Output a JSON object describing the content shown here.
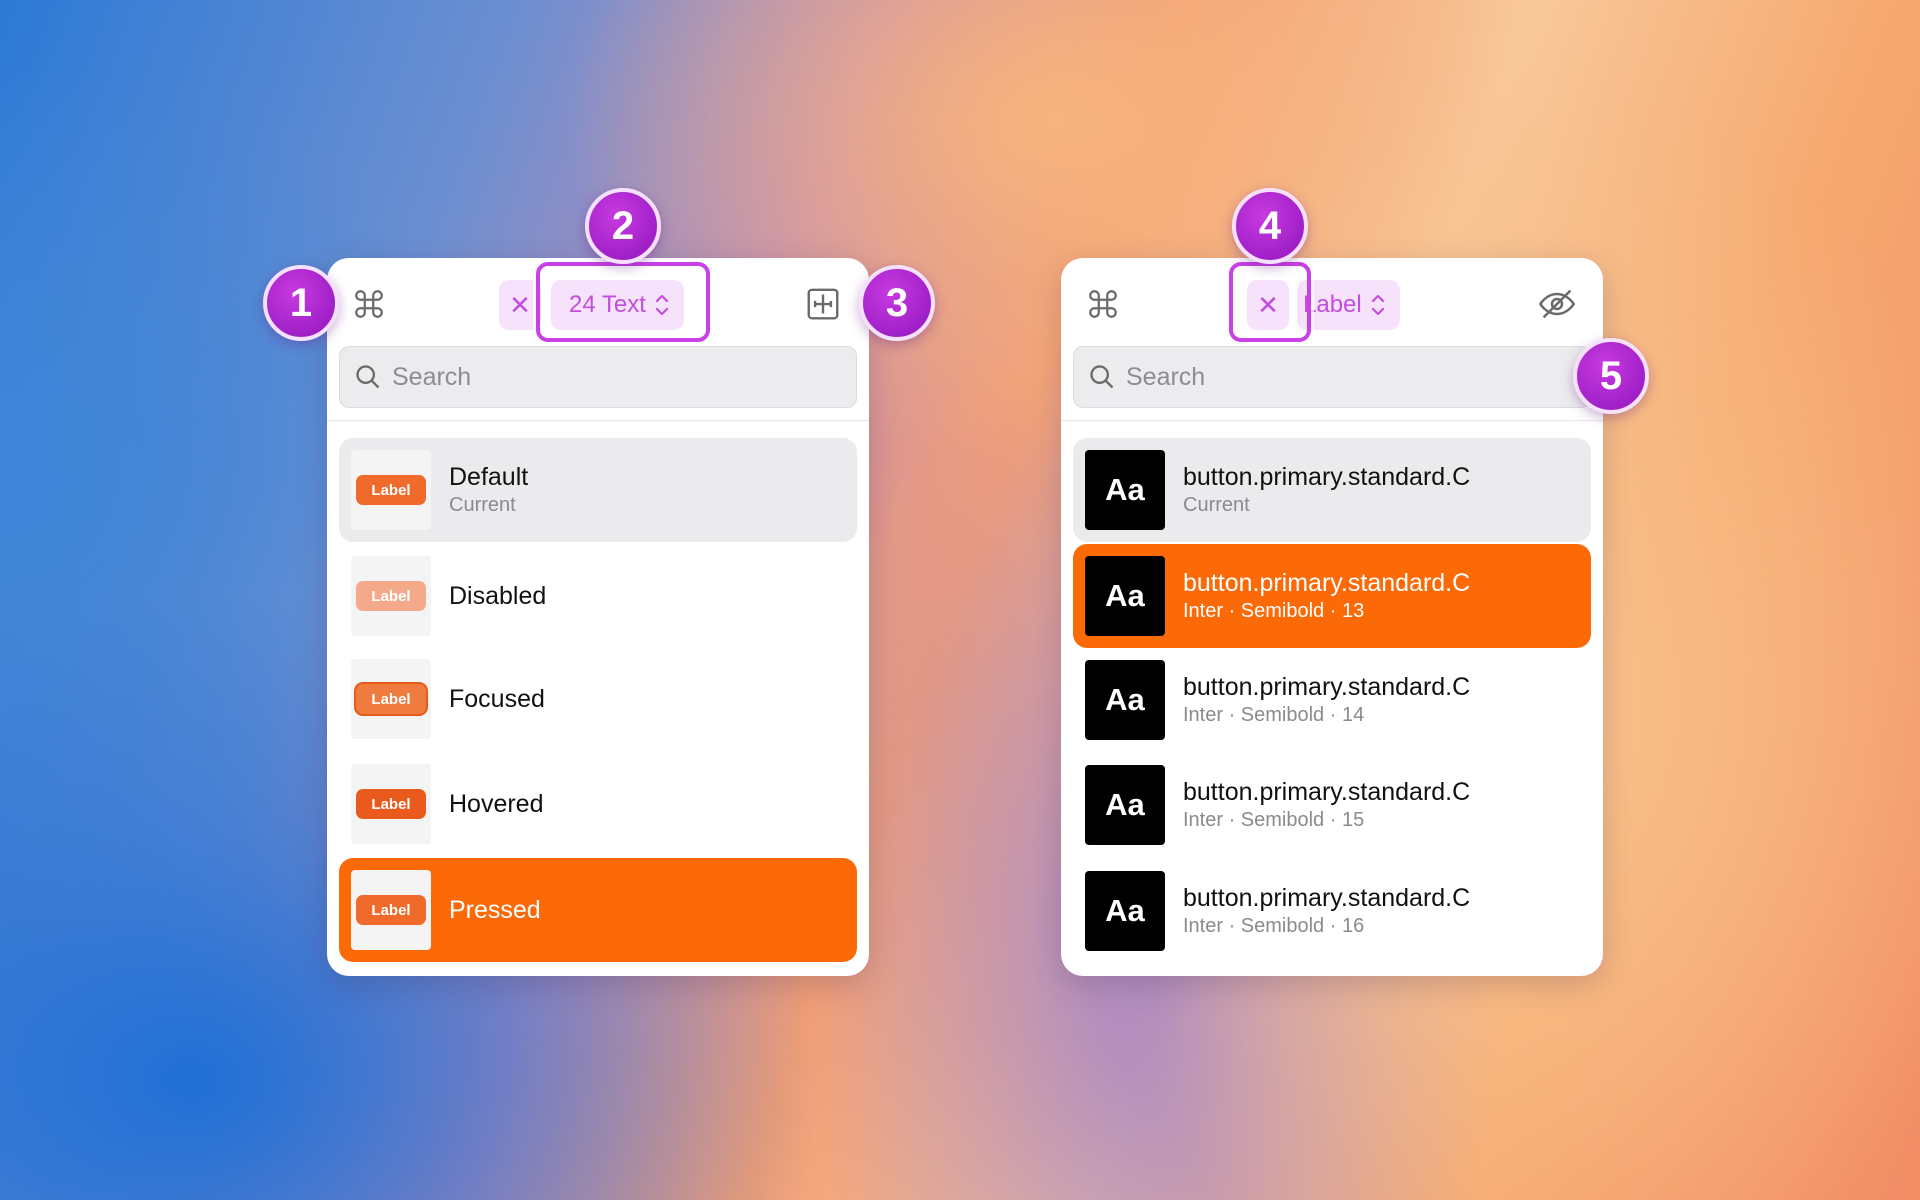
{
  "left_panel": {
    "selector_count_label": "24 Text",
    "search_placeholder": "Search",
    "items": [
      {
        "thumb_label": "Label",
        "title": "Default",
        "subtitle": "Current"
      },
      {
        "thumb_label": "Label",
        "title": "Disabled",
        "subtitle": ""
      },
      {
        "thumb_label": "Label",
        "title": "Focused",
        "subtitle": ""
      },
      {
        "thumb_label": "Label",
        "title": "Hovered",
        "subtitle": ""
      },
      {
        "thumb_label": "Label",
        "title": "Pressed",
        "subtitle": ""
      }
    ]
  },
  "right_panel": {
    "selector_label": "Label",
    "search_placeholder": "Search",
    "items": [
      {
        "thumb": "Aa",
        "title": "button.primary.standard.C",
        "subtitle": "Current"
      },
      {
        "thumb": "Aa",
        "title": "button.primary.standard.C",
        "subtitle": "Inter · Semibold · 13"
      },
      {
        "thumb": "Aa",
        "title": "button.primary.standard.C",
        "subtitle": "Inter · Semibold · 14"
      },
      {
        "thumb": "Aa",
        "title": "button.primary.standard.C",
        "subtitle": "Inter · Semibold · 15"
      },
      {
        "thumb": "Aa",
        "title": "button.primary.standard.C",
        "subtitle": "Inter · Semibold · 16"
      }
    ]
  },
  "badges": [
    "1",
    "2",
    "3",
    "4",
    "5"
  ],
  "icons": {
    "command": "command-icon",
    "close": "close-icon",
    "chevron": "chevron-updown-icon",
    "resize": "text-resize-icon",
    "eye_slash": "eye-slash-icon",
    "search": "search-icon"
  },
  "colors": {
    "accent": "#fb6a07",
    "chip_bg": "#f7e2fb",
    "chip_text": "#c34ddd",
    "badge": "#a020c8"
  }
}
